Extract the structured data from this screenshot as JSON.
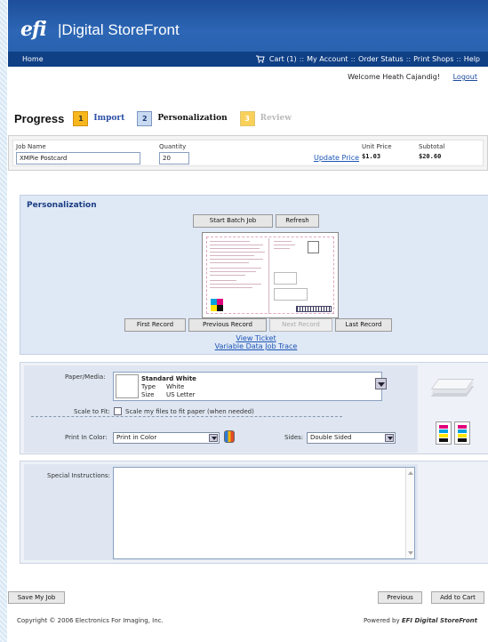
{
  "header": {
    "logo": "efi",
    "title": "Digital StoreFront",
    "brand_color": "#2c66b4"
  },
  "nav": {
    "home": "Home",
    "cart": "Cart (1)",
    "my_account": "My Account",
    "order_status": "Order Status",
    "print_shops": "Print Shops",
    "help": "Help",
    "separator": "::"
  },
  "user": {
    "welcome": "Welcome Heath Cajandig!",
    "logout": "Logout"
  },
  "progress": {
    "title": "Progress",
    "steps": [
      {
        "num": "1",
        "label": "Import"
      },
      {
        "num": "2",
        "label": "Personalization"
      },
      {
        "num": "3",
        "label": "Review"
      }
    ]
  },
  "job": {
    "name_label": "Job Name",
    "name_value": "XMPie Postcard",
    "qty_label": "Quantity",
    "qty_value": "20",
    "update_price": "Update Price",
    "unit_price_label": "Unit Price",
    "unit_price_value": "$1.03",
    "subtotal_label": "Subtotal",
    "subtotal_value": "$20.60"
  },
  "personalization": {
    "title": "Personalization",
    "start_batch": "Start Batch Job",
    "refresh": "Refresh",
    "first_record": "First Record",
    "previous_record": "Previous Record",
    "next_record": "Next Record",
    "last_record": "Last Record",
    "view_ticket": "View Ticket",
    "variable_trace": "Variable Data Job Trace"
  },
  "media": {
    "paper_label": "Paper/Media:",
    "paper_name": "Standard White",
    "type_label": "Type",
    "type_value": "White",
    "size_label": "Size",
    "size_value": "US Letter",
    "scale_label": "Scale to Fit:",
    "scale_text": "Scale my files to fit paper (when needed)",
    "color_label": "Print In Color:",
    "color_value": "Print in Color",
    "sides_label": "Sides:",
    "sides_value": "Double Sided"
  },
  "instructions": {
    "label": "Special Instructions:",
    "value": ""
  },
  "actions": {
    "save": "Save My Job",
    "previous": "Previous",
    "add_to_cart": "Add to Cart"
  },
  "footer": {
    "copyright": "Copyright © 2006 Electronics For Imaging, Inc.",
    "powered_prefix": "Powered by",
    "powered_brand": "EFI Digital StoreFront"
  }
}
